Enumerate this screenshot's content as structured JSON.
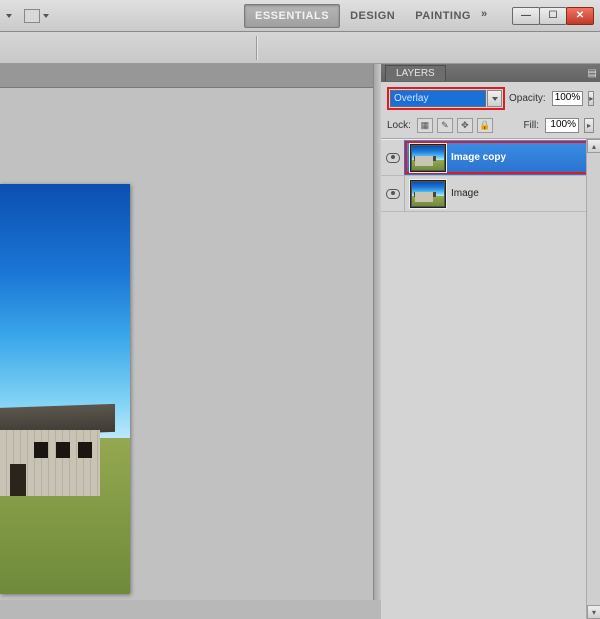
{
  "menubar": {
    "workspaces": [
      "ESSENTIALS",
      "DESIGN",
      "PAINTING"
    ],
    "active_workspace": "ESSENTIALS"
  },
  "window_controls": {
    "minimize": "—",
    "maximize": "☐",
    "close": "✕"
  },
  "panel": {
    "tab_label": "LAYERS",
    "blend_mode": {
      "value": "Overlay"
    },
    "opacity": {
      "label": "Opacity:",
      "value": "100%"
    },
    "fill": {
      "label": "Fill:",
      "value": "100%"
    },
    "lock": {
      "label": "Lock:"
    },
    "layers": [
      {
        "name": "Image copy",
        "selected": true,
        "visible": true
      },
      {
        "name": "Image",
        "selected": false,
        "visible": true
      }
    ]
  }
}
